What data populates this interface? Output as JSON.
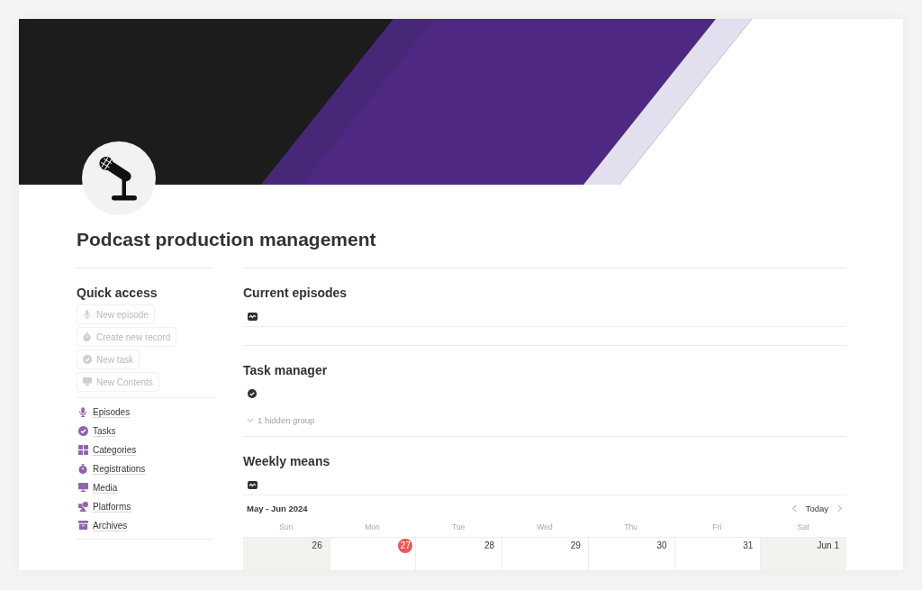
{
  "page": {
    "title": "Podcast production management"
  },
  "quick_access": {
    "title": "Quick access",
    "buttons": [
      {
        "label": "New episode",
        "disabled": true
      },
      {
        "label": "Create new record",
        "disabled": true
      },
      {
        "label": "New task",
        "disabled": true
      },
      {
        "label": "New Contents",
        "disabled": true
      }
    ]
  },
  "links": [
    {
      "label": "Episodes"
    },
    {
      "label": "Tasks"
    },
    {
      "label": "Categories"
    },
    {
      "label": "Registrations"
    },
    {
      "label": "Media"
    },
    {
      "label": "Platforms"
    },
    {
      "label": "Archives"
    }
  ],
  "sections": [
    {
      "kind": "empty",
      "title": "Current episodes"
    },
    {
      "kind": "list",
      "title": "Task manager",
      "hidden_groups": "1 hidden group"
    },
    {
      "kind": "calendar",
      "title": "Weekly means",
      "calendar": {
        "range": "May - Jun 2024",
        "today_button": "Today",
        "weekdays": [
          "Sun",
          "Mon",
          "Tue",
          "Wed",
          "Thu",
          "Fri",
          "Sat"
        ],
        "days": [
          {
            "label": "26",
            "weekend": true,
            "today": false
          },
          {
            "label": "27",
            "weekend": false,
            "today": true
          },
          {
            "label": "28",
            "weekend": false,
            "today": false
          },
          {
            "label": "29",
            "weekend": false,
            "today": false
          },
          {
            "label": "30",
            "weekend": false,
            "today": false
          },
          {
            "label": "31",
            "weekend": false,
            "today": false
          },
          {
            "label": "Jun 1",
            "weekend": true,
            "today": false
          }
        ]
      }
    }
  ]
}
